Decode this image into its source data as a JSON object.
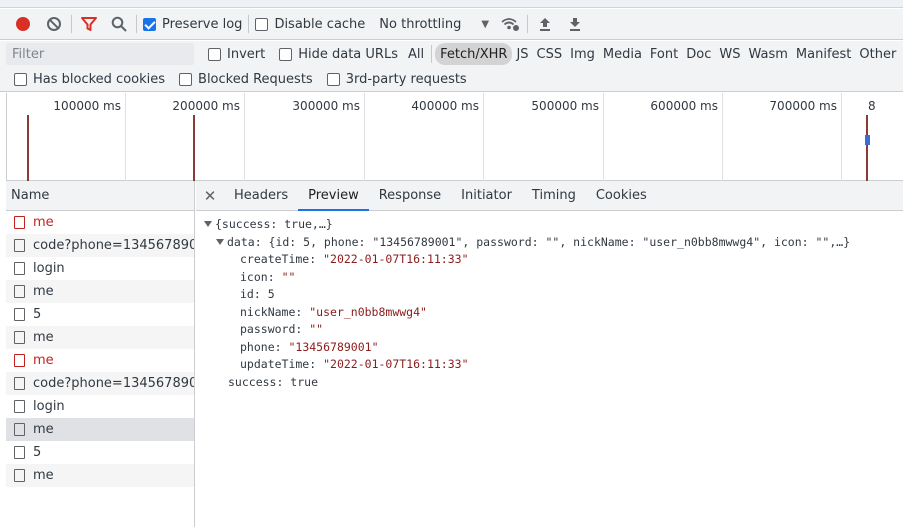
{
  "toolbar": {
    "preserve_log_label": "Preserve log",
    "preserve_log_checked": true,
    "disable_cache_label": "Disable cache",
    "disable_cache_checked": false,
    "throttling_value": "No throttling"
  },
  "filter": {
    "placeholder": "Filter",
    "invert_label": "Invert",
    "hide_data_urls_label": "Hide data URLs",
    "types": [
      "All",
      "Fetch/XHR",
      "JS",
      "CSS",
      "Img",
      "Media",
      "Font",
      "Doc",
      "WS",
      "Wasm",
      "Manifest",
      "Other"
    ],
    "active_type": "Fetch/XHR",
    "blocked_cookies_label": "Has blocked cookies",
    "blocked_requests_label": "Blocked Requests",
    "third_party_label": "3rd-party requests"
  },
  "timeline": {
    "ticks": [
      "100000 ms",
      "200000 ms",
      "300000 ms",
      "400000 ms",
      "500000 ms",
      "600000 ms",
      "700000 ms",
      "8"
    ]
  },
  "requests": {
    "header": "Name",
    "rows": [
      {
        "name": "me",
        "error": true
      },
      {
        "name": "code?phone=134567890...",
        "error": false
      },
      {
        "name": "login",
        "error": false
      },
      {
        "name": "me",
        "error": false
      },
      {
        "name": "5",
        "error": false
      },
      {
        "name": "me",
        "error": false
      },
      {
        "name": "me",
        "error": true
      },
      {
        "name": "code?phone=134567890...",
        "error": false
      },
      {
        "name": "login",
        "error": false
      },
      {
        "name": "me",
        "error": false,
        "selected": true
      },
      {
        "name": "5",
        "error": false
      },
      {
        "name": "me",
        "error": false
      }
    ]
  },
  "details": {
    "tabs": [
      "Headers",
      "Preview",
      "Response",
      "Initiator",
      "Timing",
      "Cookies"
    ],
    "active_tab": "Preview",
    "preview": {
      "root_summary": "{success: true,…}",
      "data_summary": "data: {id: 5, phone: \"13456789001\", password: \"\", nickName: \"user_n0bb8mwwg4\", icon: \"\",…}",
      "fields": [
        {
          "key": "createTime",
          "value": "\"2022-01-07T16:11:33\"",
          "type": "str"
        },
        {
          "key": "icon",
          "value": "\"\"",
          "type": "str"
        },
        {
          "key": "id",
          "value": "5",
          "type": "num"
        },
        {
          "key": "nickName",
          "value": "\"user_n0bb8mwwg4\"",
          "type": "str"
        },
        {
          "key": "password",
          "value": "\"\"",
          "type": "str"
        },
        {
          "key": "phone",
          "value": "\"13456789001\"",
          "type": "str"
        },
        {
          "key": "updateTime",
          "value": "\"2022-01-07T16:11:33\"",
          "type": "str"
        }
      ],
      "success_line": "success: true"
    }
  },
  "colors": {
    "accent": "#1a73e8",
    "record": "#d93025",
    "error_text": "#c5221f",
    "string_value": "#8a1c1c"
  }
}
